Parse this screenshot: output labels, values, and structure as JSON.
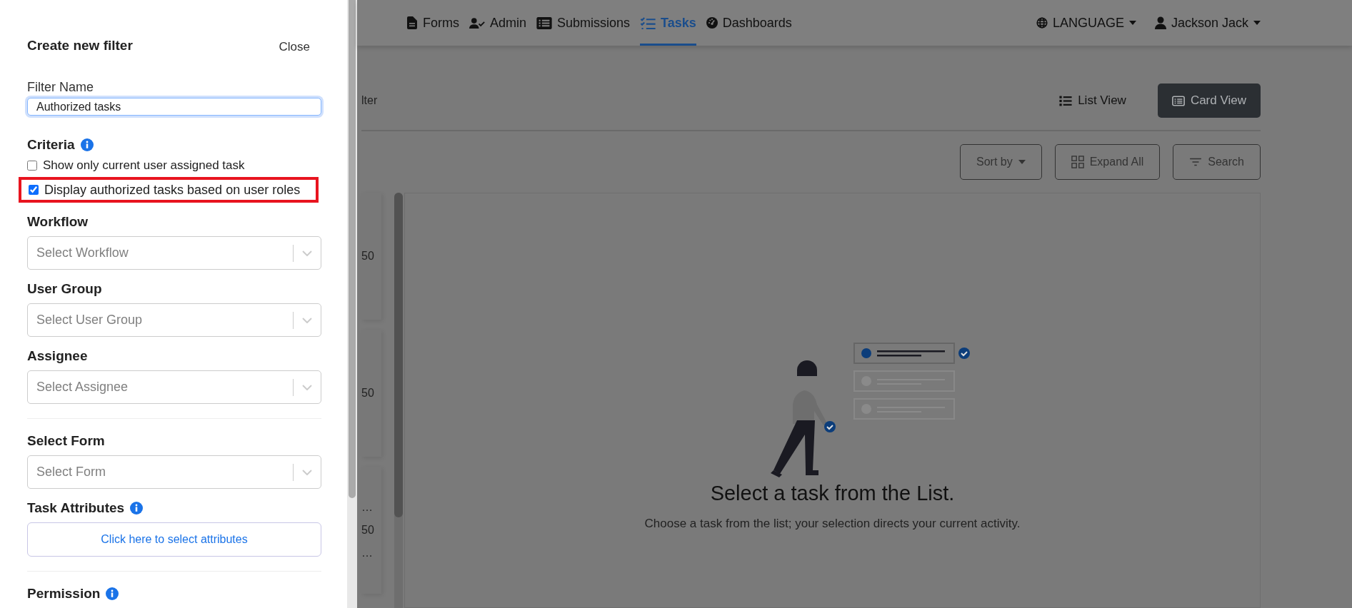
{
  "drawer": {
    "title": "Create new filter",
    "close": "Close",
    "filter_name": {
      "label": "Filter Name",
      "value": "Authorized tasks"
    },
    "criteria": {
      "label": "Criteria",
      "options": [
        {
          "label": "Show only current user assigned task",
          "checked": false,
          "highlighted": false
        },
        {
          "label": "Display authorized tasks based on user roles",
          "checked": true,
          "highlighted": true
        }
      ]
    },
    "sections": [
      {
        "kind": "select",
        "label": "Workflow",
        "placeholder": "Select Workflow",
        "info": false,
        "divider_above": false
      },
      {
        "kind": "select",
        "label": "User Group",
        "placeholder": "Select User Group",
        "info": false,
        "divider_above": false
      },
      {
        "kind": "select",
        "label": "Assignee",
        "placeholder": "Select Assignee",
        "info": false,
        "divider_above": false
      },
      {
        "kind": "select",
        "label": "Select Form",
        "placeholder": "Select Form",
        "info": false,
        "divider_above": true
      },
      {
        "kind": "button",
        "label": "Task Attributes",
        "button": "Click here to select attributes",
        "info": true,
        "divider_above": false
      },
      {
        "kind": "heading",
        "label": "Permission",
        "info": true,
        "divider_above": true
      }
    ]
  },
  "nav": {
    "items": [
      {
        "label": "Forms",
        "selected": false
      },
      {
        "label": "Admin",
        "selected": false
      },
      {
        "label": "Submissions",
        "selected": false
      },
      {
        "label": "Tasks",
        "selected": true
      },
      {
        "label": "Dashboards",
        "selected": false
      }
    ],
    "language": "LANGUAGE",
    "user": "Jackson Jack"
  },
  "filter_tab": "lter",
  "views": [
    {
      "label": "List View",
      "selected": false
    },
    {
      "label": "Card View",
      "selected": true
    }
  ],
  "toolbar": [
    "Sort by",
    "Expand All",
    "Search"
  ],
  "cards": [
    {
      "lines": [
        "50"
      ]
    },
    {
      "lines": [
        "50"
      ]
    },
    {
      "lines": [
        "…",
        "50",
        "…"
      ]
    }
  ],
  "empty_state": {
    "title": "Select a task from the List.",
    "text": "Choose a task from the list; your selection directs your current activity."
  }
}
